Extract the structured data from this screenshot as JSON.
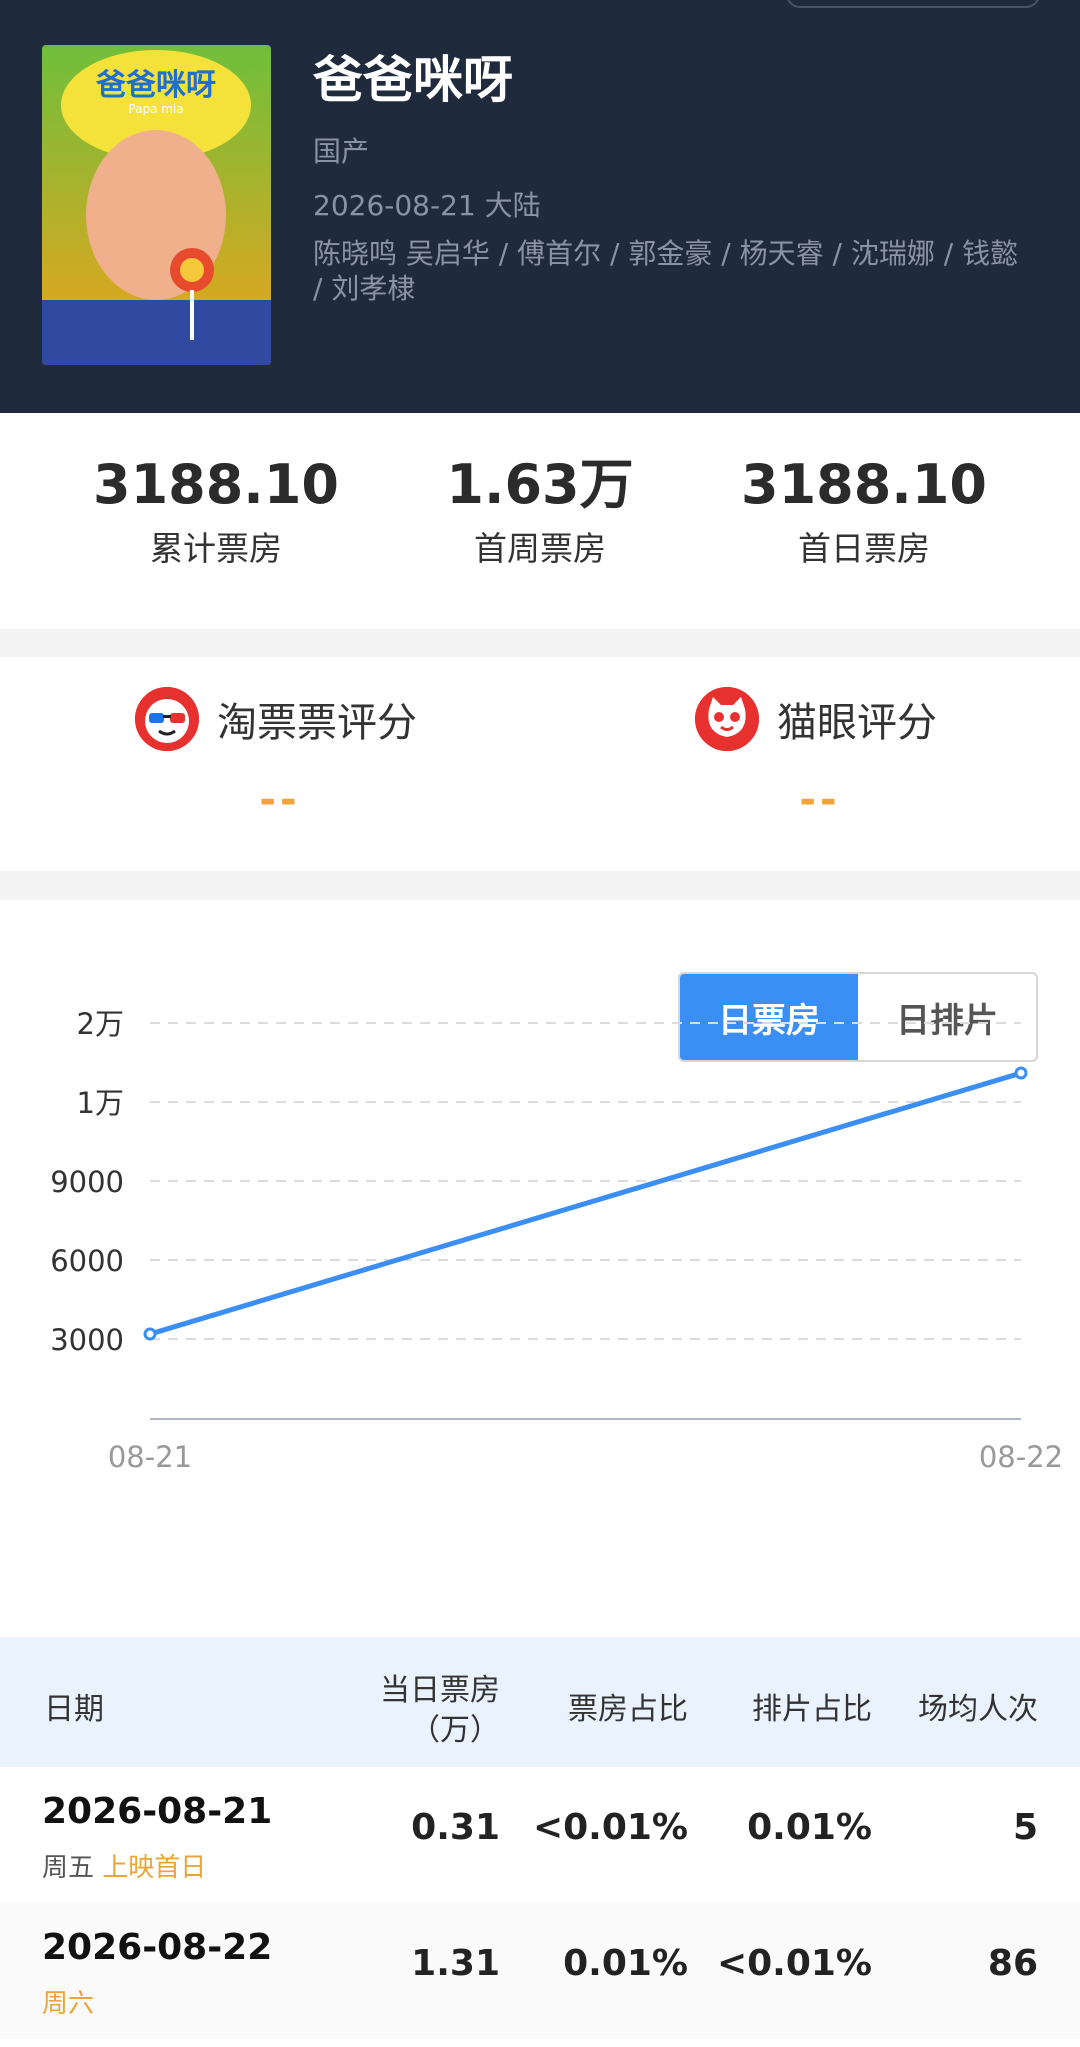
{
  "movie": {
    "title": "爸爸咪呀",
    "genre": "国产",
    "release": "2026-08-21 大陆",
    "cast": "陈晓鸣 吴启华 / 傅首尔 / 郭金豪 / 杨天睿 / 沈瑞娜 / 钱懿 / 刘孝棣",
    "poster_text": "爸爸咪呀",
    "poster_sub": "Papa mia"
  },
  "stats": [
    {
      "value": "3188.10",
      "label": "累计票房"
    },
    {
      "value": "1.63万",
      "label": "首周票房"
    },
    {
      "value": "3188.10",
      "label": "首日票房"
    }
  ],
  "ratings": [
    {
      "label": "淘票票评分",
      "value": "--",
      "icon": "taopiaopiao-icon"
    },
    {
      "label": "猫眼评分",
      "value": "--",
      "icon": "maoyan-cat-icon"
    }
  ],
  "toggle": {
    "active": "日票房",
    "inactive": "日排片"
  },
  "colors": {
    "accent": "#3b8ef3",
    "header_bg": "#1f2a3c",
    "highlight": "#e9a53a",
    "brand_red": "#e7312f"
  },
  "chart_data": {
    "type": "line",
    "x": [
      "08-21",
      "08-22"
    ],
    "yticks": [
      "3000",
      "6000",
      "9000",
      "1万",
      "2万"
    ],
    "series": [
      {
        "values": [
          3188.1,
          13100
        ]
      }
    ],
    "grid": true
  },
  "table": {
    "headers": {
      "date": "日期",
      "box_line1": "当日票房",
      "box_line2": "（万）",
      "box_share": "票房占比",
      "screen_share": "排片占比",
      "avg": "场均人次"
    },
    "rows": [
      {
        "date": "2026-08-21",
        "weekday": "周五",
        "tag": "上映首日",
        "box": "0.31",
        "box_share": "<0.01%",
        "screen_share": "0.01%",
        "avg": "5"
      },
      {
        "date": "2026-08-22",
        "weekday": "周六",
        "tag": "",
        "box": "1.31",
        "box_share": "0.01%",
        "screen_share": "<0.01%",
        "avg": "86"
      }
    ]
  }
}
